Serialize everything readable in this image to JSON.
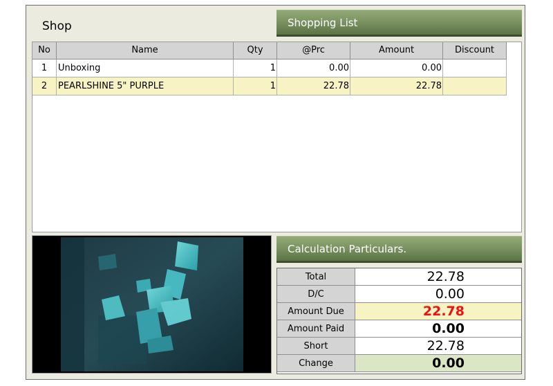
{
  "shop": {
    "title": "Shop"
  },
  "shopping_list": {
    "header": "Shopping List",
    "columns": [
      "No",
      "Name",
      "Qty",
      "@Prc",
      "Amount",
      "Discount"
    ],
    "rows": [
      {
        "no": "1",
        "name": "Unboxing",
        "qty": "1",
        "prc": "0.00",
        "amount": "0.00",
        "discount": ""
      },
      {
        "no": "2",
        "name": "PEARLSHINE 5\" PURPLE",
        "qty": "1",
        "prc": "22.78",
        "amount": "22.78",
        "discount": ""
      }
    ]
  },
  "calculation": {
    "header": "Calculation Particulars.",
    "total_label": "Total",
    "total_value": "22.78",
    "dc_label": "D/C",
    "dc_value": "0.00",
    "due_label": "Amount Due",
    "due_value": "22.78",
    "paid_label": "Amount Paid",
    "paid_value": "0.00",
    "short_label": "Short",
    "short_value": "22.78",
    "change_label": "Change",
    "change_value": "0.00"
  },
  "colors": {
    "header_green": "#7b9462",
    "selected_row": "#f7f3c2",
    "amount_due_red": "#ee1111",
    "change_green": "#dbe6c4"
  }
}
